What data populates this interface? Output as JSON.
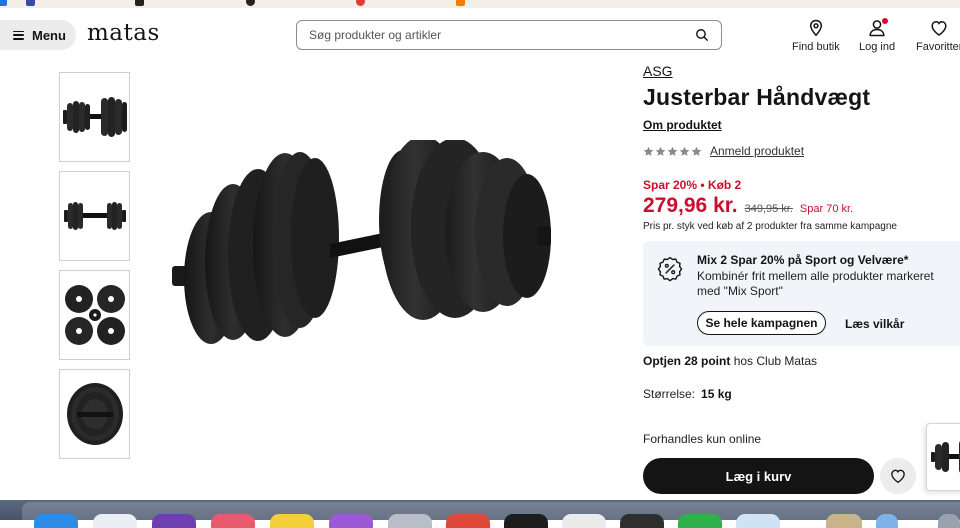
{
  "bookmarks": [
    {
      "label": "",
      "color": "#1a73e8"
    },
    {
      "label": "",
      "color": "#3949ab"
    },
    {
      "label": "",
      "color": "#222222"
    },
    {
      "label": "",
      "color": "#222222"
    },
    {
      "label": "",
      "color": "#e53935"
    },
    {
      "label": "",
      "color": "#f57c00"
    }
  ],
  "header": {
    "menu_label": "Menu",
    "logo": "matas",
    "search_placeholder": "Søg produkter og artikler",
    "find_store": "Find butik",
    "login": "Log ind",
    "favorites": "Favoritter"
  },
  "product": {
    "brand": "ASG",
    "title": "Justerbar Håndvægt",
    "about_link": "Om produktet",
    "rating_stars": 0,
    "review_link": "Anmeld produktet",
    "promo_line": "Spar 20% • Køb 2",
    "price": "279,96 kr.",
    "old_price": "349,95 kr.",
    "saving": "Spar 70 kr.",
    "price_note": "Pris pr. styk ved køb af 2 produkter fra samme kampagne",
    "points_bold": "Optjen 28 point",
    "points_rest": "hos Club Matas",
    "size_label": "Størrelse:",
    "size_value": "15 kg",
    "online_note": "Forhandles kun online",
    "cart_button": "Læg i kurv"
  },
  "campaign": {
    "title": "Mix 2 Spar 20% på Sport og Velvære*",
    "description": "Kombinér frit mellem alle produkter markeret med \"Mix Sport\"",
    "cta": "Se hele kampagnen",
    "terms": "Læs vilkår"
  },
  "colors": {
    "accent_red": "#c8102e",
    "dark": "#141414",
    "campaign_bg": "#f1f4f9"
  },
  "thumbnails": [
    "dumbbell-side",
    "dumbbell-front",
    "weight-plates",
    "dumbbell-end"
  ]
}
